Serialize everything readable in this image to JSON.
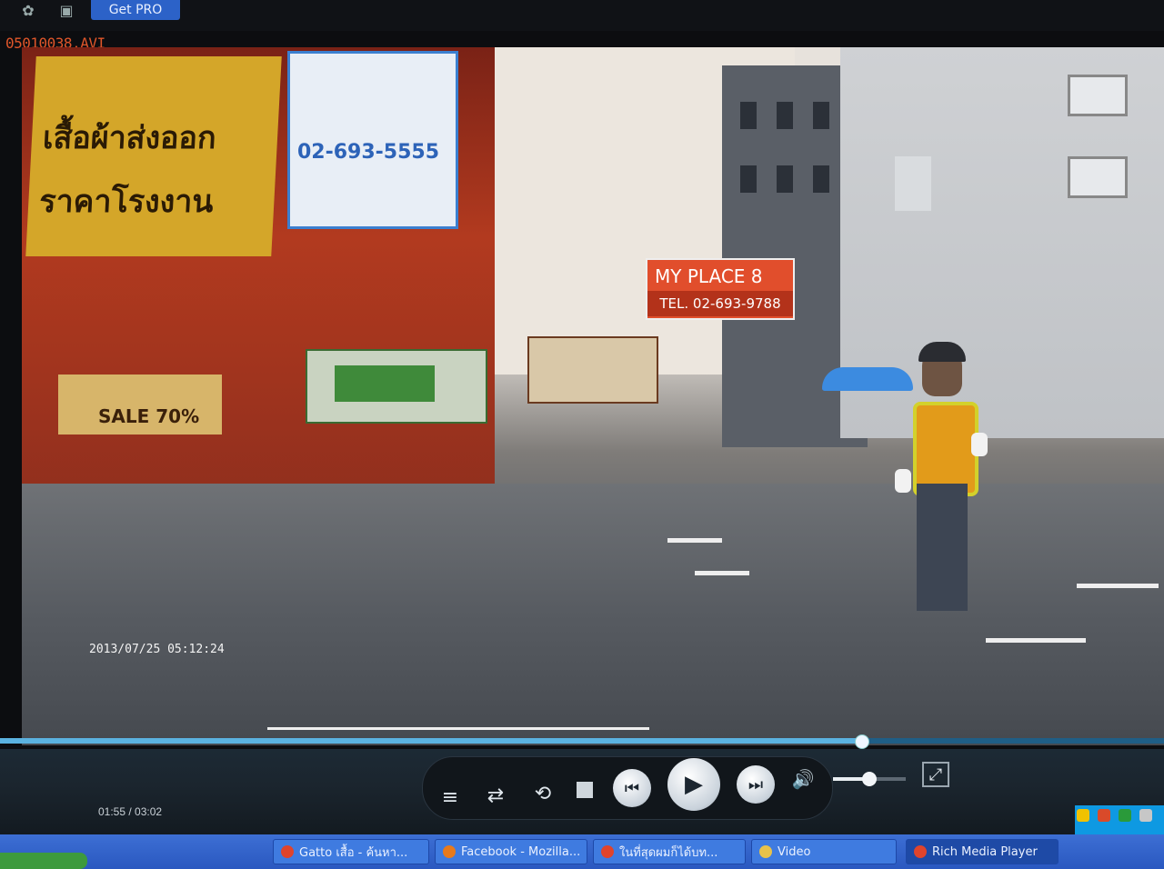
{
  "app": {
    "get_pro_label": "Get PRO",
    "filename": "05010038.AVI"
  },
  "video": {
    "timestamp_overlay": "2013/07/25 05:12:24",
    "signs": {
      "yellow_banner_line1": "เสื้อผ้าส่งออก",
      "yellow_banner_line2": "ราคาโรงงาน",
      "blue_sign_phone": "02-693-5555",
      "myplace_name": "MY PLACE 8",
      "myplace_tel": "TEL. 02-693-9788",
      "sale_sign": "SALE 70%"
    }
  },
  "player": {
    "time_display": "01:55 / 03:02",
    "progress_fraction": 0.74,
    "volume_fraction": 0.5,
    "icons": {
      "playlist": "playlist-icon",
      "shuffle": "shuffle-icon",
      "repeat": "repeat-icon",
      "stop": "stop-icon",
      "previous": "previous-icon",
      "play": "play-icon",
      "next": "next-icon",
      "volume": "volume-icon",
      "fullscreen": "fullscreen-icon"
    }
  },
  "taskbar": {
    "items": [
      {
        "label": "Gatto เสื้อ - ค้นหา...",
        "icon_color": "#e0442c"
      },
      {
        "label": "Facebook - Mozilla...",
        "icon_color": "#e87a1c"
      },
      {
        "label": "ในที่สุดผมก็ได้บท...",
        "icon_color": "#e0442c"
      },
      {
        "label": "Video",
        "icon_color": "#e8c24a"
      },
      {
        "label": "Rich Media Player",
        "icon_color": "#e0442c"
      }
    ]
  },
  "colors": {
    "accent": "#2c62c8",
    "seek_fill": "#5bb2e0",
    "filename": "#e0562a"
  }
}
